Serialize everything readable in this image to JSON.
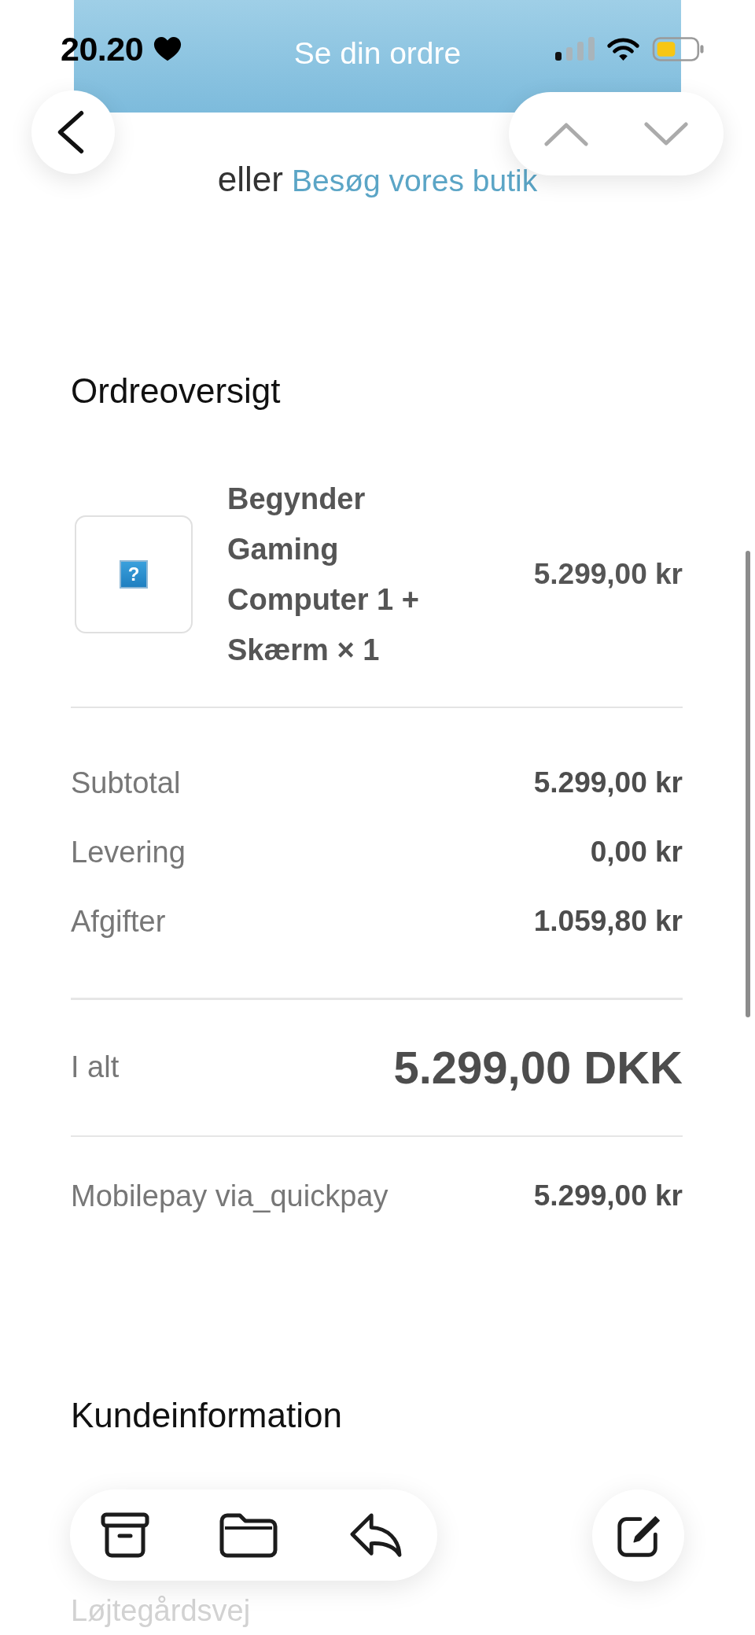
{
  "status_bar": {
    "time": "20.20"
  },
  "header_banner": {
    "title": "Se din ordre"
  },
  "store_link": {
    "prefix": "eller",
    "link": "Besøg vores butik"
  },
  "order_summary": {
    "heading": "Ordreoversigt",
    "items": [
      {
        "image_placeholder": "?",
        "name": "Begynder Gaming Computer 1 + Skærm × 1",
        "price": "5.299,00 kr"
      }
    ],
    "lines": [
      {
        "label": "Subtotal",
        "value": "5.299,00 kr"
      },
      {
        "label": "Levering",
        "value": "0,00 kr"
      },
      {
        "label": "Afgifter",
        "value": "1.059,80 kr"
      }
    ],
    "total": {
      "label": "I alt",
      "value": "5.299,00 DKK"
    },
    "payments": [
      {
        "label": "Mobilepay via_quickpay",
        "value": "5.299,00 kr"
      }
    ]
  },
  "customer_info": {
    "heading": "Kundeinformation",
    "lines": [
      "Løjtegårdsvej"
    ]
  }
}
